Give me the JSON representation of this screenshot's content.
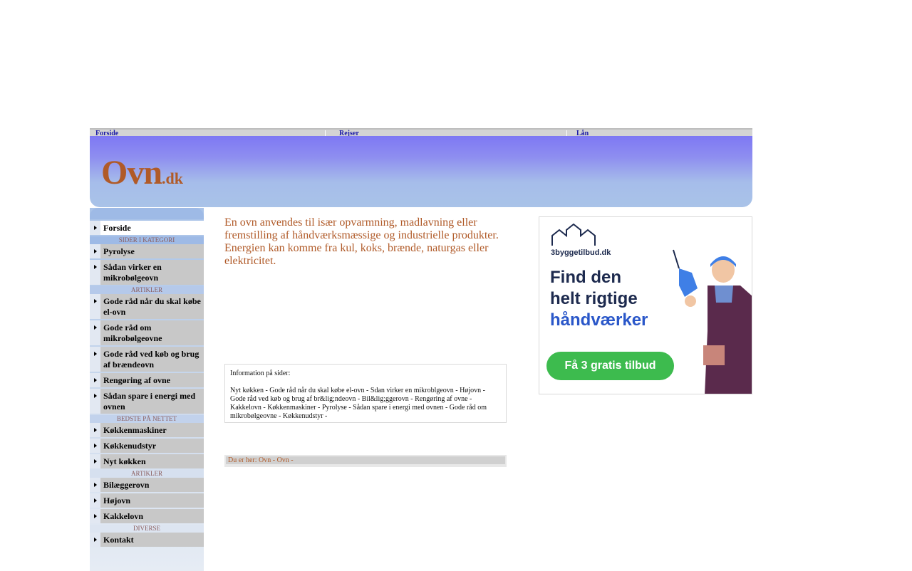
{
  "topnav": {
    "items": [
      {
        "label": "Forside"
      },
      {
        "label": "Rejser"
      },
      {
        "label": "Lån"
      }
    ]
  },
  "header": {
    "logo_main": "Ovn",
    "logo_suffix": ".dk"
  },
  "sidebar": {
    "items": [
      {
        "type": "item",
        "label": "Forside",
        "active": true
      },
      {
        "type": "section",
        "label": "SIDER I KATEGORI"
      },
      {
        "type": "item",
        "label": "Pyrolyse"
      },
      {
        "type": "item",
        "label": "Sådan virker en mikrobølgeovn"
      },
      {
        "type": "section",
        "label": "ARTIKLER"
      },
      {
        "type": "item",
        "label": "Gode råd når du skal købe el-ovn"
      },
      {
        "type": "item",
        "label": "Gode råd om mikrobølgeovne"
      },
      {
        "type": "item",
        "label": "Gode råd ved køb og brug af brændeovn"
      },
      {
        "type": "item",
        "label": "Rengøring af ovne"
      },
      {
        "type": "item",
        "label": "Sådan spare i energi med ovnen"
      },
      {
        "type": "section",
        "label": "BEDSTE PÅ NETTET"
      },
      {
        "type": "item",
        "label": "Køkkenmaskiner"
      },
      {
        "type": "item",
        "label": "Køkkenudstyr"
      },
      {
        "type": "item",
        "label": "Nyt køkken"
      },
      {
        "type": "section",
        "label": "ARTIKLER"
      },
      {
        "type": "item",
        "label": "Bilæggerovn"
      },
      {
        "type": "item",
        "label": "Højovn"
      },
      {
        "type": "item",
        "label": "Kakkelovn"
      },
      {
        "type": "section",
        "label": "DIVERSE"
      },
      {
        "type": "item",
        "label": "Kontakt"
      }
    ]
  },
  "main": {
    "intro": "En ovn anvendes til især opvarmning, madlavning eller fremstilling af håndværksmæssige og industrielle produkter. Energien kan komme fra kul, koks, brænde, naturgas eller elektricitet.",
    "info_label": "Information på sider:",
    "info_links": "Nyt køkken - Gode råd når du skal købe el-ovn - Sdan virker en mikroblgeovn - Højovn - Gode råd ved køb og brug af br&lig;ndeovn - Bil&lig;ggerovn - Rengøring af ovne - Kakkelovn - Køkkenmaskiner - Pyrolyse - Sådan spare i energi med ovnen - Gode råd om mikrobølgeovne - Køkkenudstyr -",
    "breadcrumb": "Du er her: Ovn - Ovn -"
  },
  "ad": {
    "brand": "3byggetilbud.dk",
    "headline_1": "Find den",
    "headline_2": "helt rigtige",
    "headline_3": "håndværker",
    "button": "Få 3 gratis tilbud"
  }
}
